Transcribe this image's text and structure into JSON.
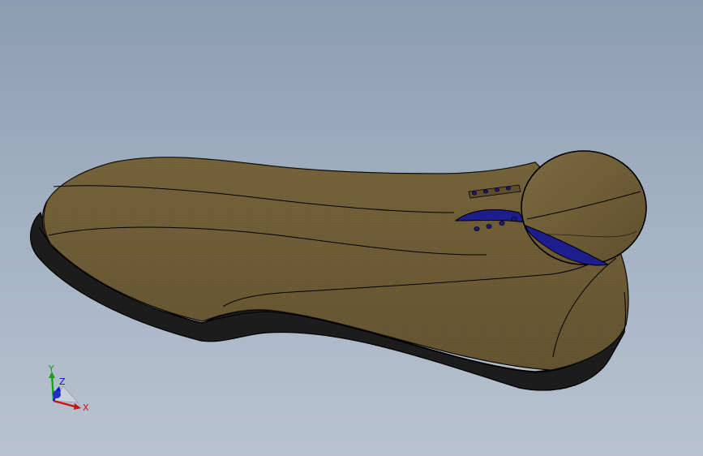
{
  "viewport": {
    "background_top": "#8c9cb1",
    "background_bottom": "#b9c3d0"
  },
  "model": {
    "upper_color": "#6e5c36",
    "sole_color": "#1c1c1c",
    "insole_color": "#1d1d8e",
    "edge_color": "#000000"
  },
  "triad": {
    "x_label": "X",
    "y_label": "Y",
    "z_label": "Z",
    "x_color": "#d01010",
    "y_color": "#10a010",
    "z_color": "#1010d0"
  }
}
